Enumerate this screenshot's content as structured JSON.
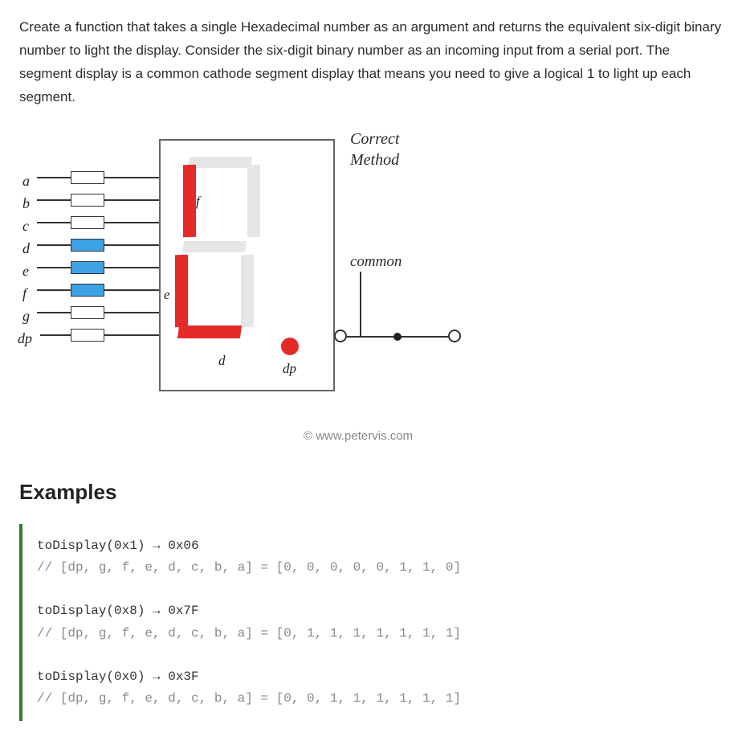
{
  "description": "Create a function that takes a single Hexadecimal number as an argument and returns the equivalent six-digit binary number to light the display. Consider the six-digit binary number as an incoming input from a serial port. The segment display is a common cathode segment display that means you need to give a logical 1 to light up each segment.",
  "diagram": {
    "correct_title_1": "Correct",
    "correct_title_2": "Method",
    "common_label": "common",
    "pins": [
      "a",
      "b",
      "c",
      "d",
      "e",
      "f",
      "g",
      "dp"
    ],
    "inner_labels": {
      "f": "f",
      "e": "e",
      "d": "d",
      "dp": "dp"
    },
    "credit": "© www.petervis.com"
  },
  "examples_heading": "Examples",
  "examples": [
    {
      "call": "toDisplay(0x1) → 0x06",
      "comment": "// [dp, g, f, e, d, c, b, a] = [0, 0, 0, 0, 0, 1, 1, 0]"
    },
    {
      "call": "toDisplay(0x8) → 0x7F",
      "comment": "// [dp, g, f, e, d, c, b, a] = [0, 1, 1, 1, 1, 1, 1, 1]"
    },
    {
      "call": "toDisplay(0x0) → 0x3F",
      "comment": "// [dp, g, f, e, d, c, b, a] = [0, 0, 1, 1, 1, 1, 1, 1]"
    }
  ]
}
